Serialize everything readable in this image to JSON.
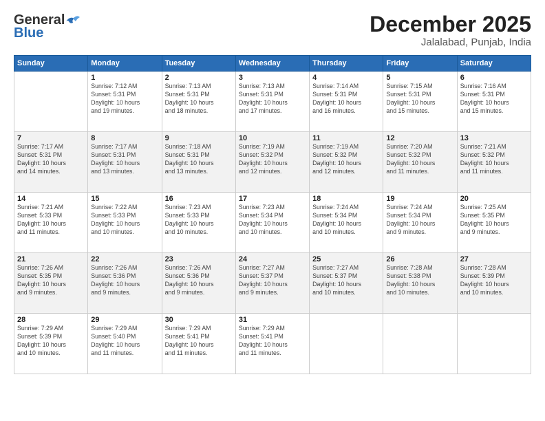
{
  "header": {
    "logo_general": "General",
    "logo_blue": "Blue",
    "title": "December 2025",
    "subtitle": "Jalalabad, Punjab, India"
  },
  "calendar": {
    "days_of_week": [
      "Sunday",
      "Monday",
      "Tuesday",
      "Wednesday",
      "Thursday",
      "Friday",
      "Saturday"
    ],
    "weeks": [
      [
        {
          "day": "",
          "info": ""
        },
        {
          "day": "1",
          "info": "Sunrise: 7:12 AM\nSunset: 5:31 PM\nDaylight: 10 hours\nand 19 minutes."
        },
        {
          "day": "2",
          "info": "Sunrise: 7:13 AM\nSunset: 5:31 PM\nDaylight: 10 hours\nand 18 minutes."
        },
        {
          "day": "3",
          "info": "Sunrise: 7:13 AM\nSunset: 5:31 PM\nDaylight: 10 hours\nand 17 minutes."
        },
        {
          "day": "4",
          "info": "Sunrise: 7:14 AM\nSunset: 5:31 PM\nDaylight: 10 hours\nand 16 minutes."
        },
        {
          "day": "5",
          "info": "Sunrise: 7:15 AM\nSunset: 5:31 PM\nDaylight: 10 hours\nand 15 minutes."
        },
        {
          "day": "6",
          "info": "Sunrise: 7:16 AM\nSunset: 5:31 PM\nDaylight: 10 hours\nand 15 minutes."
        }
      ],
      [
        {
          "day": "7",
          "info": "Sunrise: 7:17 AM\nSunset: 5:31 PM\nDaylight: 10 hours\nand 14 minutes."
        },
        {
          "day": "8",
          "info": "Sunrise: 7:17 AM\nSunset: 5:31 PM\nDaylight: 10 hours\nand 13 minutes."
        },
        {
          "day": "9",
          "info": "Sunrise: 7:18 AM\nSunset: 5:31 PM\nDaylight: 10 hours\nand 13 minutes."
        },
        {
          "day": "10",
          "info": "Sunrise: 7:19 AM\nSunset: 5:32 PM\nDaylight: 10 hours\nand 12 minutes."
        },
        {
          "day": "11",
          "info": "Sunrise: 7:19 AM\nSunset: 5:32 PM\nDaylight: 10 hours\nand 12 minutes."
        },
        {
          "day": "12",
          "info": "Sunrise: 7:20 AM\nSunset: 5:32 PM\nDaylight: 10 hours\nand 11 minutes."
        },
        {
          "day": "13",
          "info": "Sunrise: 7:21 AM\nSunset: 5:32 PM\nDaylight: 10 hours\nand 11 minutes."
        }
      ],
      [
        {
          "day": "14",
          "info": "Sunrise: 7:21 AM\nSunset: 5:33 PM\nDaylight: 10 hours\nand 11 minutes."
        },
        {
          "day": "15",
          "info": "Sunrise: 7:22 AM\nSunset: 5:33 PM\nDaylight: 10 hours\nand 10 minutes."
        },
        {
          "day": "16",
          "info": "Sunrise: 7:23 AM\nSunset: 5:33 PM\nDaylight: 10 hours\nand 10 minutes."
        },
        {
          "day": "17",
          "info": "Sunrise: 7:23 AM\nSunset: 5:34 PM\nDaylight: 10 hours\nand 10 minutes."
        },
        {
          "day": "18",
          "info": "Sunrise: 7:24 AM\nSunset: 5:34 PM\nDaylight: 10 hours\nand 10 minutes."
        },
        {
          "day": "19",
          "info": "Sunrise: 7:24 AM\nSunset: 5:34 PM\nDaylight: 10 hours\nand 9 minutes."
        },
        {
          "day": "20",
          "info": "Sunrise: 7:25 AM\nSunset: 5:35 PM\nDaylight: 10 hours\nand 9 minutes."
        }
      ],
      [
        {
          "day": "21",
          "info": "Sunrise: 7:26 AM\nSunset: 5:35 PM\nDaylight: 10 hours\nand 9 minutes."
        },
        {
          "day": "22",
          "info": "Sunrise: 7:26 AM\nSunset: 5:36 PM\nDaylight: 10 hours\nand 9 minutes."
        },
        {
          "day": "23",
          "info": "Sunrise: 7:26 AM\nSunset: 5:36 PM\nDaylight: 10 hours\nand 9 minutes."
        },
        {
          "day": "24",
          "info": "Sunrise: 7:27 AM\nSunset: 5:37 PM\nDaylight: 10 hours\nand 9 minutes."
        },
        {
          "day": "25",
          "info": "Sunrise: 7:27 AM\nSunset: 5:37 PM\nDaylight: 10 hours\nand 10 minutes."
        },
        {
          "day": "26",
          "info": "Sunrise: 7:28 AM\nSunset: 5:38 PM\nDaylight: 10 hours\nand 10 minutes."
        },
        {
          "day": "27",
          "info": "Sunrise: 7:28 AM\nSunset: 5:39 PM\nDaylight: 10 hours\nand 10 minutes."
        }
      ],
      [
        {
          "day": "28",
          "info": "Sunrise: 7:29 AM\nSunset: 5:39 PM\nDaylight: 10 hours\nand 10 minutes."
        },
        {
          "day": "29",
          "info": "Sunrise: 7:29 AM\nSunset: 5:40 PM\nDaylight: 10 hours\nand 11 minutes."
        },
        {
          "day": "30",
          "info": "Sunrise: 7:29 AM\nSunset: 5:41 PM\nDaylight: 10 hours\nand 11 minutes."
        },
        {
          "day": "31",
          "info": "Sunrise: 7:29 AM\nSunset: 5:41 PM\nDaylight: 10 hours\nand 11 minutes."
        },
        {
          "day": "",
          "info": ""
        },
        {
          "day": "",
          "info": ""
        },
        {
          "day": "",
          "info": ""
        }
      ]
    ]
  }
}
